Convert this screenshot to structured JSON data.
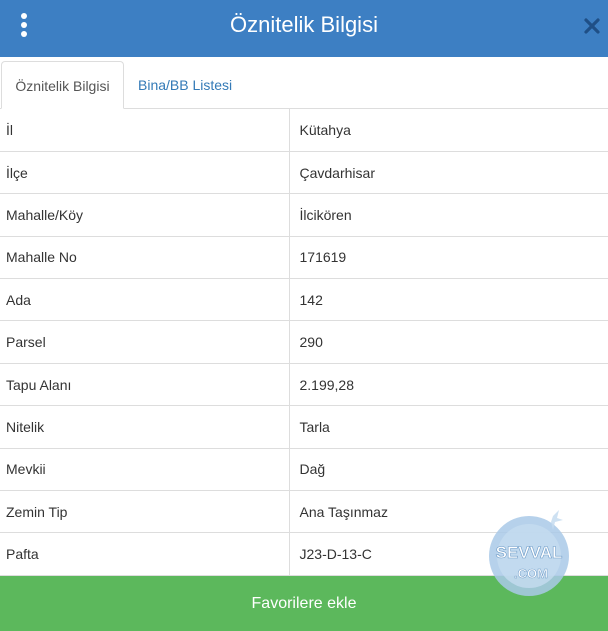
{
  "header": {
    "title": "Öznitelik Bilgisi",
    "menu_icon": "vertical-dots-icon",
    "close_icon": "close-icon",
    "background_color": "#3d7fc3"
  },
  "tabs": [
    {
      "label": "Öznitelik Bilgisi",
      "active": true
    },
    {
      "label": "Bina/BB Listesi",
      "active": false
    }
  ],
  "attributes": [
    {
      "key": "İl",
      "value": "Kütahya"
    },
    {
      "key": "İlçe",
      "value": "Çavdarhisar"
    },
    {
      "key": "Mahalle/Köy",
      "value": "İlcikören"
    },
    {
      "key": "Mahalle No",
      "value": "171619"
    },
    {
      "key": "Ada",
      "value": "142"
    },
    {
      "key": "Parsel",
      "value": "290"
    },
    {
      "key": "Tapu Alanı",
      "value": "2.199,28"
    },
    {
      "key": "Nitelik",
      "value": "Tarla"
    },
    {
      "key": "Mevkii",
      "value": "Dağ"
    },
    {
      "key": "Zemin Tip",
      "value": "Ana Taşınmaz"
    },
    {
      "key": "Pafta",
      "value": "J23-D-13-C"
    }
  ],
  "footer": {
    "button_label": "Favorilere ekle",
    "button_color": "#5cb85c"
  },
  "watermark": {
    "text_top": "SEVVAL",
    "text_bottom": ".COM"
  }
}
